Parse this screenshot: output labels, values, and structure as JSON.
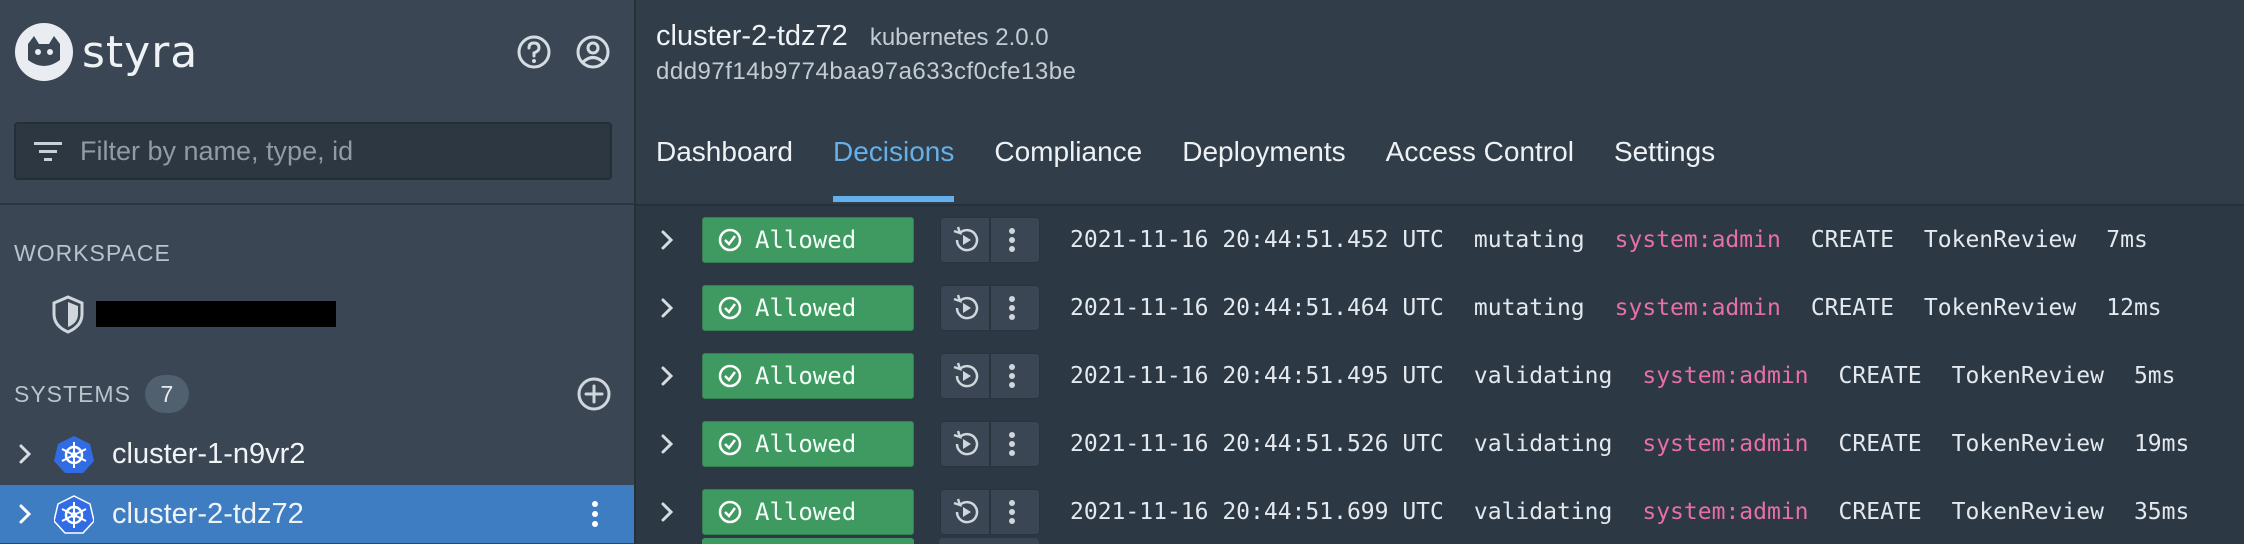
{
  "brand": {
    "name": "styra"
  },
  "header_icons": [
    "help-icon",
    "account-icon"
  ],
  "filter": {
    "placeholder": "Filter by name, type, id",
    "value": ""
  },
  "workspace": {
    "title": "WORKSPACE"
  },
  "systems": {
    "title": "SYSTEMS",
    "count": "7",
    "items": [
      {
        "label": "cluster-1-n9vr2",
        "selected": false
      },
      {
        "label": "cluster-2-tdz72",
        "selected": true
      }
    ]
  },
  "cluster": {
    "name": "cluster-2-tdz72",
    "version": "kubernetes 2.0.0",
    "id": "ddd97f14b9774baa97a633cf0cfe13be"
  },
  "tabs": [
    {
      "label": "Dashboard",
      "active": false
    },
    {
      "label": "Decisions",
      "active": true
    },
    {
      "label": "Compliance",
      "active": false
    },
    {
      "label": "Deployments",
      "active": false
    },
    {
      "label": "Access Control",
      "active": false
    },
    {
      "label": "Settings",
      "active": false
    }
  ],
  "decisions": [
    {
      "status": "Allowed",
      "timestamp": "2021-11-16 20:44:51.452 UTC",
      "kind": "mutating",
      "user": "system:admin",
      "operation": "CREATE",
      "resource": "TokenReview",
      "latency": "7ms"
    },
    {
      "status": "Allowed",
      "timestamp": "2021-11-16 20:44:51.464 UTC",
      "kind": "mutating",
      "user": "system:admin",
      "operation": "CREATE",
      "resource": "TokenReview",
      "latency": "12ms"
    },
    {
      "status": "Allowed",
      "timestamp": "2021-11-16 20:44:51.495 UTC",
      "kind": "validating",
      "user": "system:admin",
      "operation": "CREATE",
      "resource": "TokenReview",
      "latency": "5ms"
    },
    {
      "status": "Allowed",
      "timestamp": "2021-11-16 20:44:51.526 UTC",
      "kind": "validating",
      "user": "system:admin",
      "operation": "CREATE",
      "resource": "TokenReview",
      "latency": "19ms"
    },
    {
      "status": "Allowed",
      "timestamp": "2021-11-16 20:44:51.699 UTC",
      "kind": "validating",
      "user": "system:admin",
      "operation": "CREATE",
      "resource": "TokenReview",
      "latency": "35ms"
    }
  ],
  "colors": {
    "sidebar_bg": "#3a4653",
    "selected_bg": "#3f7dc2",
    "allowed_green": "#3f9a62",
    "accent_blue": "#64b0ea",
    "user_pink": "#e86ea8"
  }
}
